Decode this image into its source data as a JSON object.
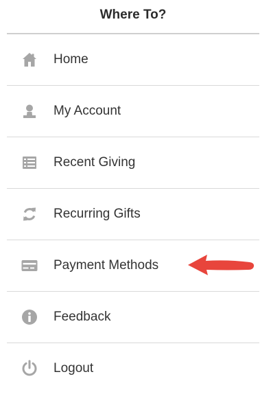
{
  "header": {
    "title": "Where To?"
  },
  "menu": {
    "items": [
      {
        "label": "Home",
        "icon": "home-icon"
      },
      {
        "label": "My Account",
        "icon": "user-icon"
      },
      {
        "label": "Recent Giving",
        "icon": "list-icon"
      },
      {
        "label": "Recurring Gifts",
        "icon": "refresh-icon"
      },
      {
        "label": "Payment Methods",
        "icon": "credit-card-icon",
        "highlighted": true
      },
      {
        "label": "Feedback",
        "icon": "info-icon"
      },
      {
        "label": "Logout",
        "icon": "power-icon"
      }
    ]
  },
  "colors": {
    "icon": "#a6a6a6",
    "annotation_arrow": "#e8453c",
    "divider": "#d9d9d9",
    "header_divider": "#cfcfcf",
    "text": "#333333"
  }
}
